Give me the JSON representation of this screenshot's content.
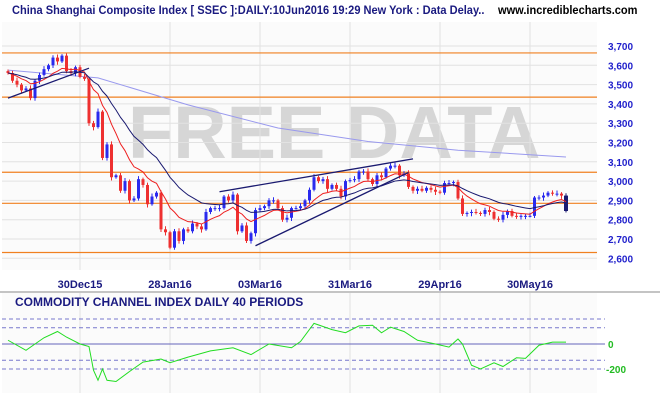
{
  "header": {
    "title": "China Shanghai Composite Index [ SSEC ]:DAILY:10Jun2016 19:29 New York : Data Delay..",
    "site": "www.incrediblecharts.com"
  },
  "watermark": "FREE DATA",
  "colors": {
    "up": "#2a2aee",
    "down": "#ee3030",
    "ema_short": "#ee2020",
    "ema_long": "#1a1a70",
    "ma_long": "#9999ee",
    "hline": "#f08020",
    "cci": "#22dd22",
    "trend": "#1a1a70"
  },
  "chart_data": [
    {
      "type": "candlestick",
      "title": "China Shanghai Composite Index [ SSEC ] DAILY",
      "ylim": [
        2560,
        3760
      ],
      "yticks": [
        2600,
        2700,
        2800,
        2900,
        3000,
        3100,
        3200,
        3300,
        3400,
        3500,
        3600,
        3700
      ],
      "ytick_labels": [
        "2,600",
        "2,700",
        "2,800",
        "2,900",
        "3,000",
        "3,100",
        "3,200",
        "3,300",
        "3,400",
        "3,500",
        "3,600",
        "3,700"
      ],
      "xticks": [
        {
          "index": 16,
          "label": "30Dec15"
        },
        {
          "index": 36,
          "label": "28Jan16"
        },
        {
          "index": 56,
          "label": "03Mar16"
        },
        {
          "index": 76,
          "label": "31Mar16"
        },
        {
          "index": 96,
          "label": "29Apr16"
        },
        {
          "index": 116,
          "label": "30May16"
        }
      ],
      "closes": [
        3560,
        3520,
        3500,
        3470,
        3480,
        3430,
        3520,
        3550,
        3580,
        3600,
        3640,
        3620,
        3650,
        3570,
        3560,
        3590,
        3540,
        3530,
        3300,
        3280,
        3360,
        3120,
        3190,
        3020,
        3030,
        2950,
        3000,
        2900,
        2910,
        3010,
        2980,
        2880,
        2920,
        2940,
        2750,
        2735,
        2655,
        2740,
        2690,
        2750,
        2740,
        2780,
        2765,
        2750,
        2840,
        2860,
        2860,
        2860,
        2920,
        2900,
        2930,
        2740,
        2770,
        2690,
        2730,
        2850,
        2860,
        2870,
        2900,
        2900,
        2860,
        2800,
        2810,
        2860,
        2860,
        2870,
        2900,
        2955,
        3020,
        3000,
        3010,
        2960,
        2980,
        2960,
        2920,
        3000,
        3005,
        3010,
        3050,
        3050,
        3010,
        2985,
        3030,
        3020,
        3065,
        3080,
        3080,
        3030,
        3040,
        2970,
        2950,
        2960,
        2950,
        2965,
        2955,
        2945,
        2940,
        2990,
        2990,
        2995,
        2910,
        2830,
        2835,
        2840,
        2835,
        2830,
        2850,
        2840,
        2805,
        2800,
        2825,
        2845,
        2820,
        2815,
        2820,
        2820,
        2820,
        2915,
        2915,
        2925,
        2940,
        2935,
        2935,
        2925,
        2845
      ],
      "ema_periods": [
        10,
        21
      ],
      "ma_long_points": [
        [
          0,
          3575
        ],
        [
          20,
          3535
        ],
        [
          40,
          3395
        ],
        [
          60,
          3275
        ],
        [
          80,
          3205
        ],
        [
          100,
          3160
        ],
        [
          124,
          3125
        ]
      ],
      "horizontal_lines": [
        3664,
        3435,
        3046,
        2885,
        2630
      ],
      "trend_lines": [
        [
          [
            0,
            3430
          ],
          [
            18,
            3585
          ]
        ],
        [
          [
            47,
            2945
          ],
          [
            90,
            3115
          ]
        ],
        [
          [
            55,
            2665
          ],
          [
            89,
            3045
          ]
        ]
      ]
    },
    {
      "type": "line",
      "title": "COMMODITY CHANNEL INDEX DAILY 40 PERIODS",
      "ylim": [
        -330,
        260
      ],
      "levels": [
        200,
        130,
        0,
        -130,
        -200
      ],
      "ytick_labels": [
        {
          "value": 0,
          "label": "0"
        },
        {
          "value": -200,
          "label": "-200"
        }
      ],
      "points": [
        [
          0,
          30
        ],
        [
          4,
          -50
        ],
        [
          6,
          0
        ],
        [
          8,
          50
        ],
        [
          11,
          100
        ],
        [
          13,
          55
        ],
        [
          16,
          0
        ],
        [
          18,
          -20
        ],
        [
          19,
          -210
        ],
        [
          20,
          -290
        ],
        [
          21,
          -200
        ],
        [
          22,
          -290
        ],
        [
          24,
          -300
        ],
        [
          27,
          -220
        ],
        [
          30,
          -145
        ],
        [
          34,
          -120
        ],
        [
          36,
          -150
        ],
        [
          40,
          -105
        ],
        [
          45,
          -55
        ],
        [
          50,
          -30
        ],
        [
          54,
          -85
        ],
        [
          58,
          0
        ],
        [
          63,
          -30
        ],
        [
          65,
          20
        ],
        [
          68,
          165
        ],
        [
          72,
          115
        ],
        [
          75,
          90
        ],
        [
          78,
          145
        ],
        [
          81,
          150
        ],
        [
          83,
          90
        ],
        [
          85,
          135
        ],
        [
          88,
          100
        ],
        [
          91,
          30
        ],
        [
          95,
          0
        ],
        [
          98,
          -25
        ],
        [
          100,
          40
        ],
        [
          101,
          0
        ],
        [
          103,
          -170
        ],
        [
          105,
          -200
        ],
        [
          108,
          -150
        ],
        [
          110,
          -180
        ],
        [
          113,
          -110
        ],
        [
          115,
          -115
        ],
        [
          118,
          -10
        ],
        [
          121,
          15
        ],
        [
          124,
          15
        ]
      ]
    }
  ]
}
